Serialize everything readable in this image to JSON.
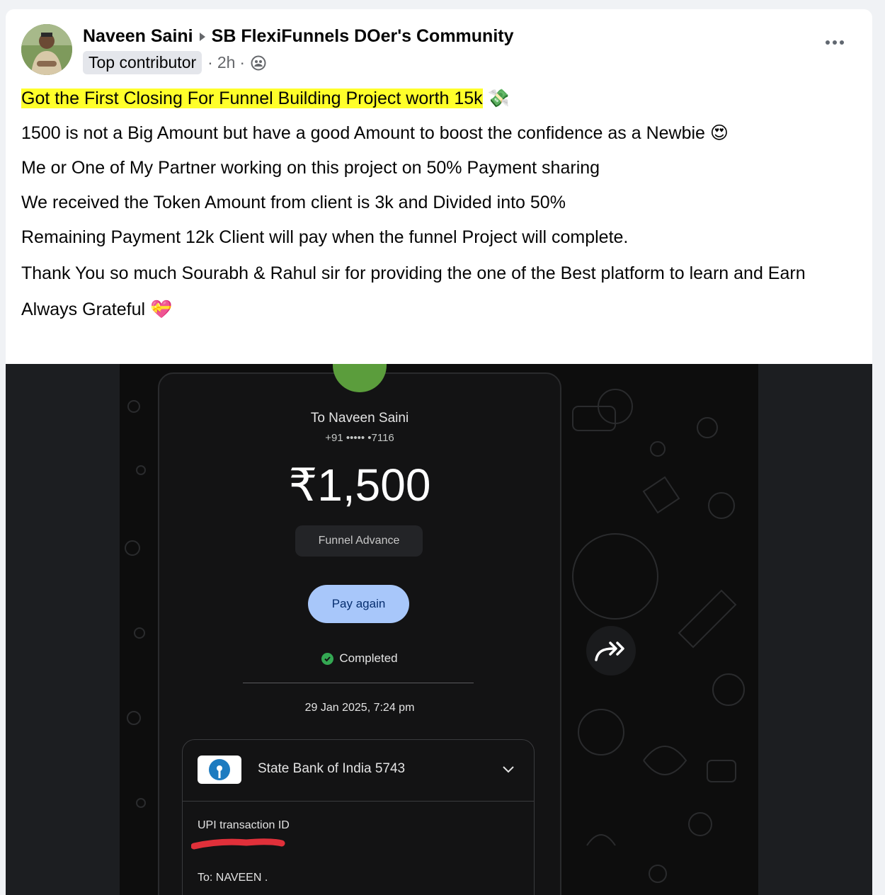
{
  "post": {
    "author": "Naveen Saini",
    "group": "SB FlexiFunnels DOer's Community",
    "badge": "Top contributor",
    "time": "2h",
    "separator": "·",
    "paragraphs": {
      "p1": "Got the First Closing For Funnel Building Project worth 15k",
      "p1_emoji": "💸",
      "p2": "1500 is not a Big Amount but have a good Amount to boost the confidence as a Newbie",
      "p2_emoji": "😍",
      "p3": "Me or One of My Partner working on this project on 50% Payment sharing",
      "p4": "We received the Token Amount from client is 3k and Divided into 50%",
      "p5": "Remaining Payment 12k Client will pay when the funnel Project will complete.",
      "p6": "Thank You so much Sourabh & Rahul sir for providing the one of the Best platform to learn and Earn",
      "p7": "Always Grateful",
      "p7_emoji": "💝"
    }
  },
  "payment": {
    "recipient": "To Naveen Saini",
    "phone": "+91 ••••• •7116",
    "amount": "₹1,500",
    "note": "Funnel Advance",
    "pay_again": "Pay again",
    "status": "Completed",
    "datetime": "29 Jan 2025, 7:24 pm",
    "bank": "State Bank of India 5743",
    "upi_label": "UPI transaction ID",
    "to_label": "To: NAVEEN ."
  },
  "colors": {
    "highlight": "#ffff2a",
    "pay_button": "#a8c7fa",
    "completed_check": "#34a853",
    "redaction": "#e0303a"
  }
}
